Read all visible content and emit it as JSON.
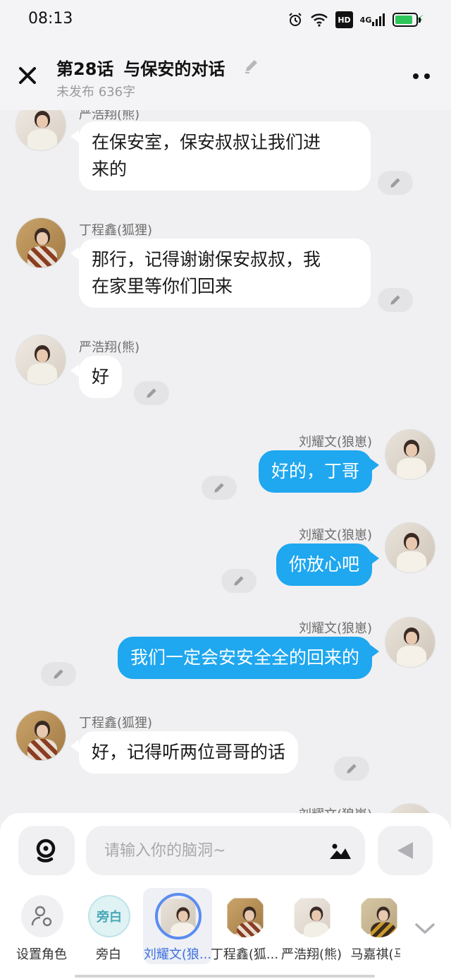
{
  "status_bar": {
    "time": "08:13",
    "hd": "HD",
    "network": "4G"
  },
  "header": {
    "chapter": "第28话",
    "title": "与保安的对话",
    "subtitle": "未发布 636字"
  },
  "messages": [
    {
      "speaker": "严浩翔(熊)",
      "side": "left",
      "text_lines": [
        "在保安室，保安叔叔让我们进",
        "来的"
      ]
    },
    {
      "speaker": "丁程鑫(狐狸)",
      "side": "left",
      "text_lines": [
        "那行，记得谢谢保安叔叔，我",
        "在家里等你们回来"
      ]
    },
    {
      "speaker": "严浩翔(熊)",
      "side": "left",
      "text_lines": [
        "好"
      ]
    },
    {
      "speaker": "刘耀文(狼崽)",
      "side": "right",
      "text_lines": [
        "好的，丁哥"
      ]
    },
    {
      "speaker": "刘耀文(狼崽)",
      "side": "right",
      "text_lines": [
        "你放心吧"
      ]
    },
    {
      "speaker": "刘耀文(狼崽)",
      "side": "right",
      "text_lines": [
        "我们一定会安安全全的回来的"
      ]
    },
    {
      "speaker": "丁程鑫(狐狸)",
      "side": "left",
      "text_lines": [
        "好，记得听两位哥哥的话"
      ]
    },
    {
      "speaker": "刘耀文(狼崽)",
      "side": "right",
      "text_lines": []
    }
  ],
  "composer": {
    "placeholder": "请输入你的脑洞~"
  },
  "roles": [
    {
      "label": "设置角色",
      "kind": "set"
    },
    {
      "label": "旁白",
      "kind": "narrator",
      "badge": "旁白"
    },
    {
      "label": "刘耀文(狼...",
      "kind": "avatar",
      "selected": true
    },
    {
      "label": "丁程鑫(狐...",
      "kind": "avatar"
    },
    {
      "label": "严浩翔(熊)",
      "kind": "avatar"
    },
    {
      "label": "马嘉祺(马",
      "kind": "avatar"
    }
  ],
  "colors": {
    "bubble_right": "#1fa7ef",
    "bubble_left": "#ffffff",
    "background": "#f0f0f2",
    "selected_role": "#3d6fe0"
  }
}
